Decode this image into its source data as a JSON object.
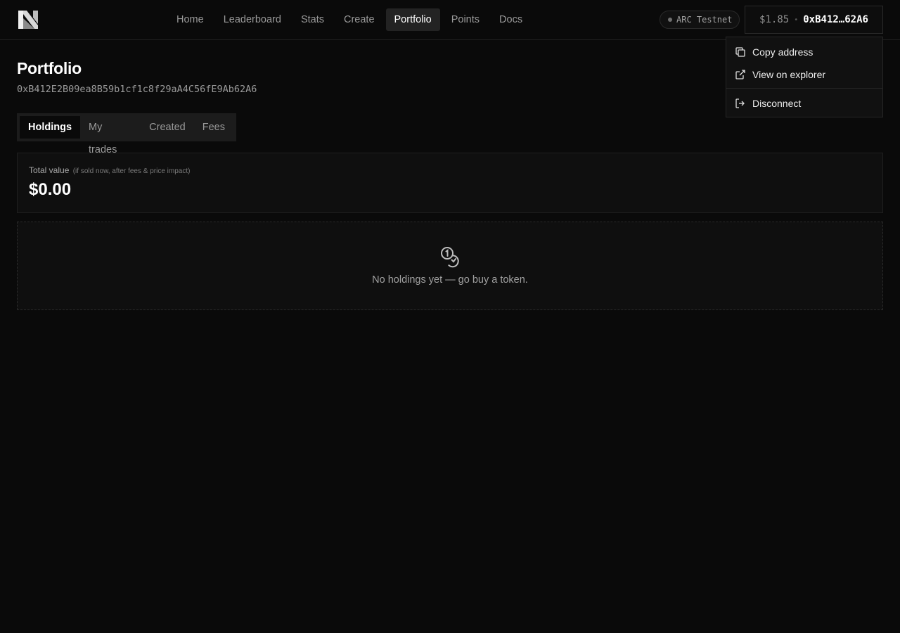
{
  "nav": {
    "items": [
      {
        "label": "Home"
      },
      {
        "label": "Leaderboard"
      },
      {
        "label": "Stats"
      },
      {
        "label": "Create"
      },
      {
        "label": "Portfolio",
        "active": true
      },
      {
        "label": "Points"
      },
      {
        "label": "Docs"
      }
    ]
  },
  "network": {
    "label": "ARC Testnet"
  },
  "wallet": {
    "balance": "$1.85",
    "separator": "•",
    "address_short": "0xB412…62A6"
  },
  "dropdown": {
    "items": [
      {
        "label": "Copy address",
        "icon": "copy-icon"
      },
      {
        "label": "View on explorer",
        "icon": "external-link-icon"
      },
      {
        "label": "Disconnect",
        "icon": "logout-icon"
      }
    ]
  },
  "page": {
    "title": "Portfolio",
    "address": "0xB412E2B09ea8B59b1cf1c8f29aA4C56fE9Ab62A6"
  },
  "tabs": [
    {
      "label": "Holdings",
      "active": true
    },
    {
      "label": "My trades"
    },
    {
      "label": "Created"
    },
    {
      "label": "Fees"
    }
  ],
  "total_value": {
    "label": "Total value",
    "note": "(if sold now, after fees & price impact)",
    "amount": "$0.00"
  },
  "empty_state": {
    "icon": "coins-icon",
    "text": "No holdings yet — go buy a token."
  }
}
